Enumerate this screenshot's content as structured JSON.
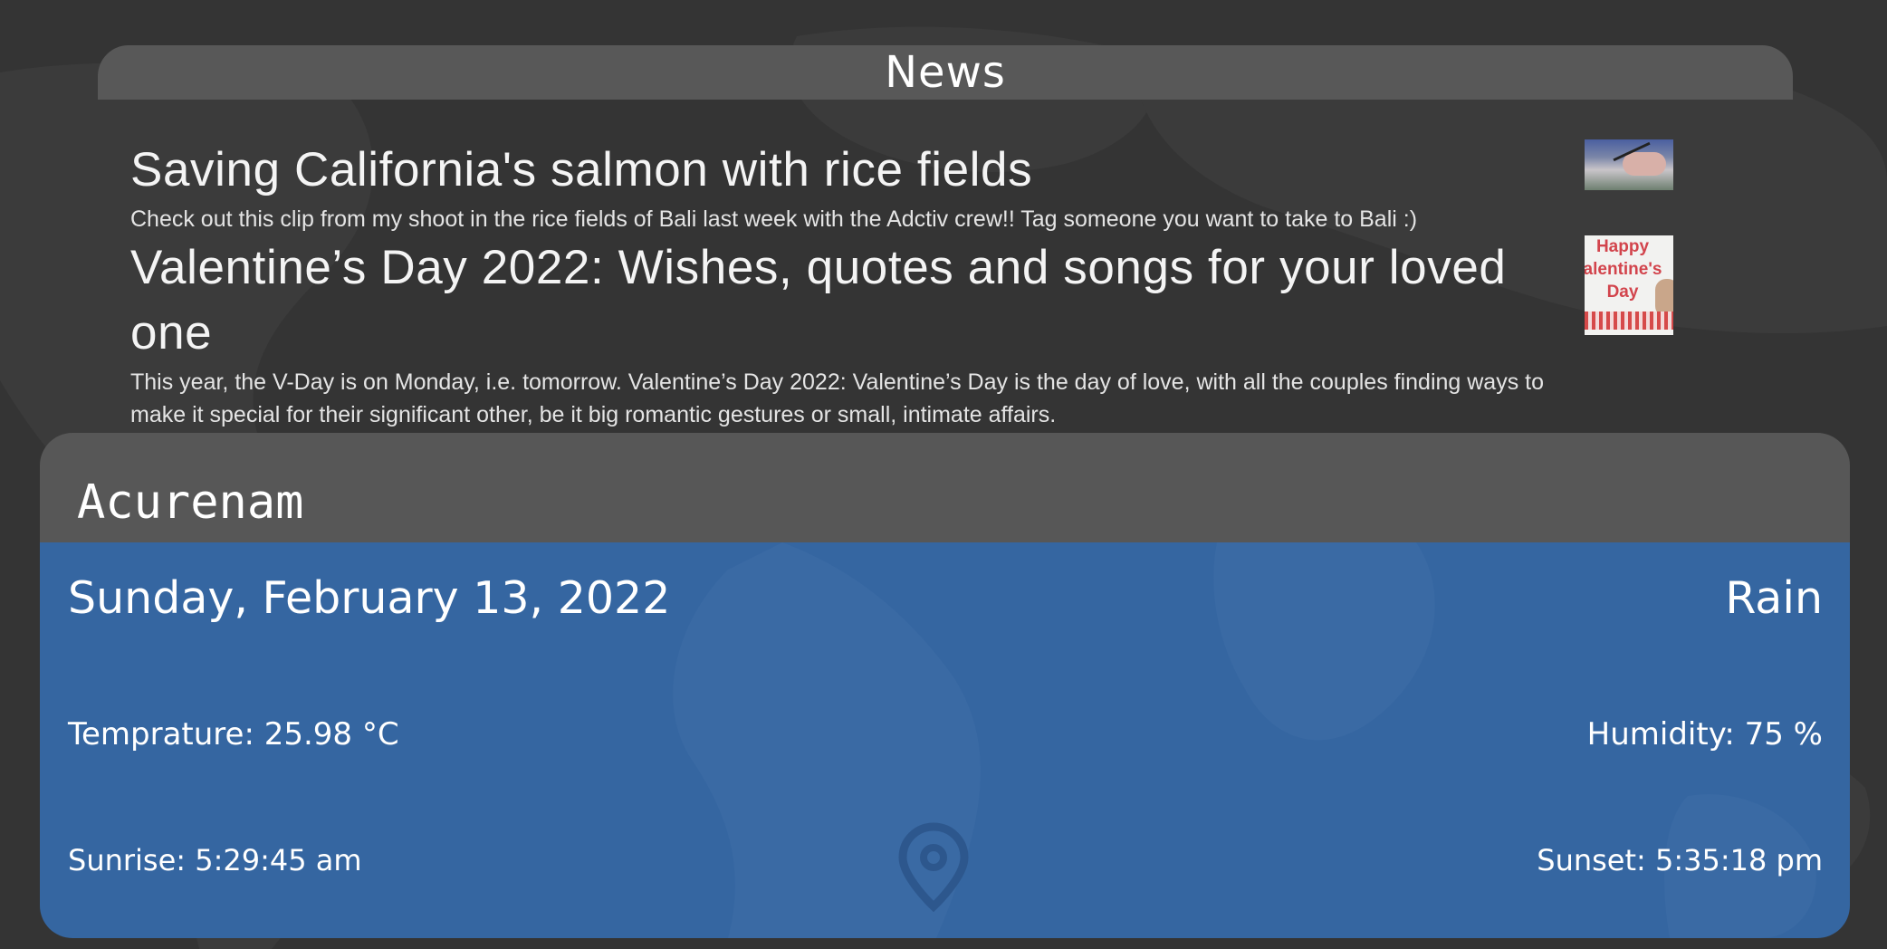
{
  "news": {
    "title": "News",
    "items": [
      {
        "headline": "Saving California's salmon with rice fields",
        "description": "Check out this clip from my shoot in the rice fields of Bali last week with the Adctiv crew!! Tag someone you want to take to Bali :)",
        "thumbnail_icon": "video-thumbnail"
      },
      {
        "headline": "Valentine’s Day 2022: Wishes, quotes and songs for your loved one",
        "description": "This year, the V-Day is on Monday, i.e. tomorrow. Valentine’s Day 2022: Valentine’s Day is the day of love, with all the couples finding ways to make it special for their significant other, be it big romantic gestures or small, intimate affairs.",
        "thumbnail_text": [
          "Happy",
          "alentine's",
          "Day"
        ]
      }
    ]
  },
  "weather": {
    "city": "Acurenam",
    "date": "Sunday, February 13, 2022",
    "condition": "Rain",
    "temperature": "Temprature: 25.98 °C",
    "humidity": "Humidity: 75 %",
    "sunrise": "Sunrise: 5:29:45 am",
    "sunset": "Sunset: 5:35:18 pm",
    "location_icon": "map-pin-icon"
  },
  "colors": {
    "page_background": "#343434",
    "panel_header": "#575757",
    "weather_blue": "#3566a1",
    "text": "#ffffff"
  }
}
